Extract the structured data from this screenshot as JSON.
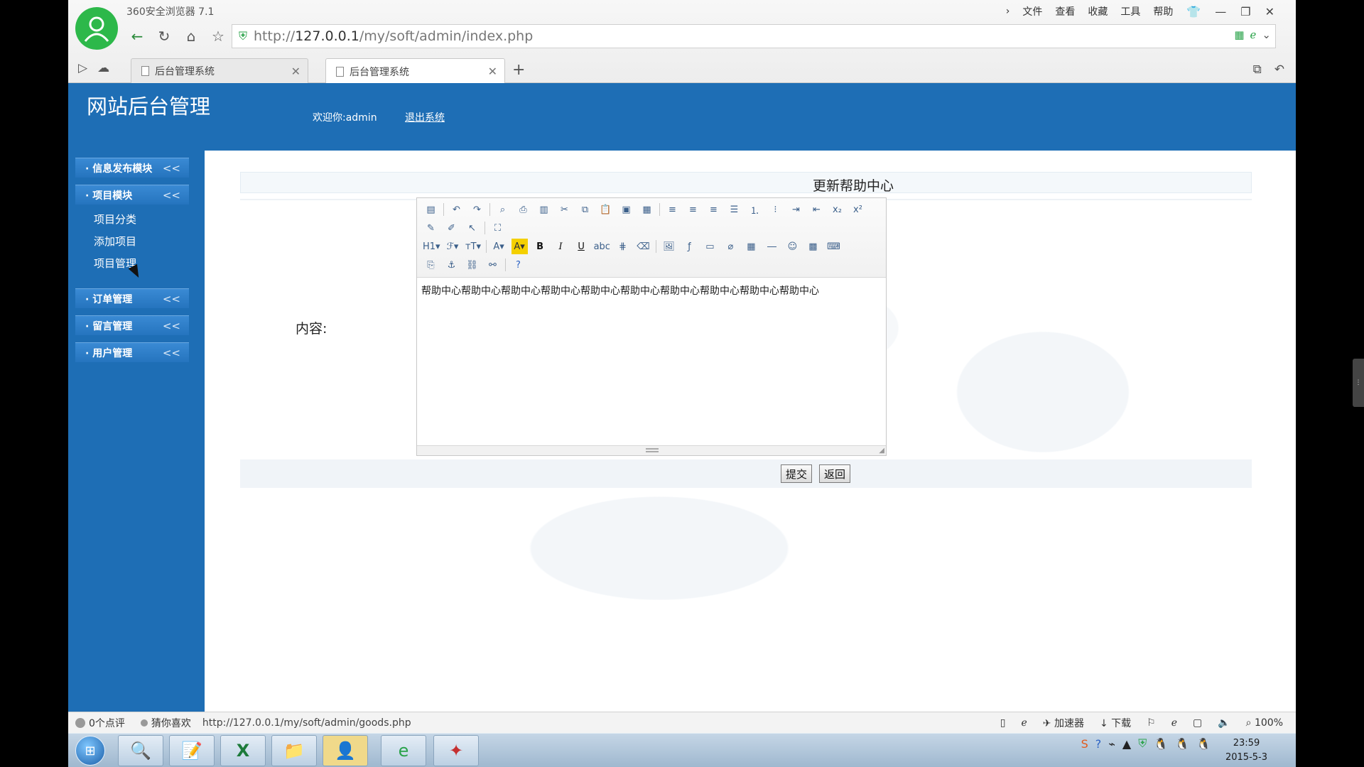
{
  "browser": {
    "app_title": "360安全浏览器 7.1",
    "menu": [
      "文件",
      "查看",
      "收藏",
      "工具",
      "帮助"
    ],
    "url_prefix": "http://",
    "url_host": "127.0.0.1",
    "url_path": "/my/soft/admin/index.php",
    "tabs": [
      {
        "label": "后台管理系统",
        "active": false
      },
      {
        "label": "后台管理系统",
        "active": true
      }
    ]
  },
  "admin": {
    "site_title": "网站后台管理",
    "welcome": "欢迎你:admin",
    "logout": "退出系统"
  },
  "sidebar": {
    "groups": [
      {
        "label": "· 信息发布模块"
      },
      {
        "label": "· 项目模块",
        "items": [
          "项目分类",
          "添加项目",
          "项目管理"
        ]
      },
      {
        "label": "· 订单管理"
      },
      {
        "label": "· 留言管理"
      },
      {
        "label": "· 用户管理"
      }
    ],
    "chevron": "<<"
  },
  "form": {
    "title": "更新帮助中心",
    "content_label": "内容:",
    "editor_text": "帮助中心帮助中心帮助中心帮助中心帮助中心帮助中心帮助中心帮助中心帮助中心帮助中心",
    "submit": "提交",
    "back": "返回"
  },
  "statusbar": {
    "comments": "0个点评",
    "guess": "猜你喜欢",
    "link_url": "http://127.0.0.1/my/soft/admin/goods.php",
    "accelerator": "加速器",
    "download": "下载",
    "zoom": "100%"
  },
  "taskbar": {
    "time": "23:59",
    "date": "2015-5-3"
  },
  "colors": {
    "admin_blue": "#1e6eb5",
    "sidebar_group": "#2574be"
  }
}
